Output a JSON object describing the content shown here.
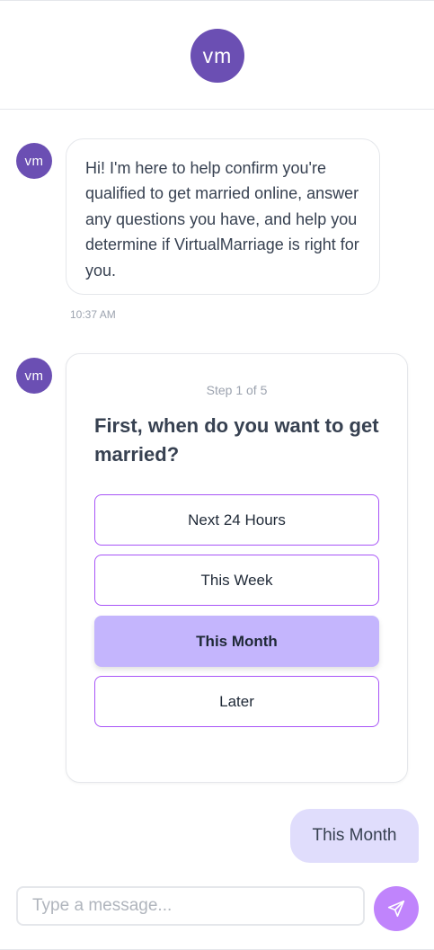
{
  "header": {
    "logo_text": "vm"
  },
  "messages": {
    "bot_avatar_text": "vm",
    "greeting": "Hi! I'm here to help confirm you're qualified to get married online, answer any questions you have, and help you determine if VirtualMarriage is right for you.",
    "greeting_time": "10:37 AM"
  },
  "question_card": {
    "step": "Step 1 of 5",
    "question": "First, when do you want to get married?",
    "options": [
      "Next 24 Hours",
      "This Week",
      "This Month",
      "Later"
    ],
    "selected": "This Month"
  },
  "user_reply": "This Month",
  "composer": {
    "placeholder": "Type a message...",
    "value": ""
  },
  "colors": {
    "brand": "#6b4fb3",
    "selected_option": "#c4b5fd",
    "option_border": "#a855f7",
    "send_button": "#c084fc",
    "user_bubble": "#e0ddfc"
  },
  "icons": {
    "send": "send-icon"
  }
}
